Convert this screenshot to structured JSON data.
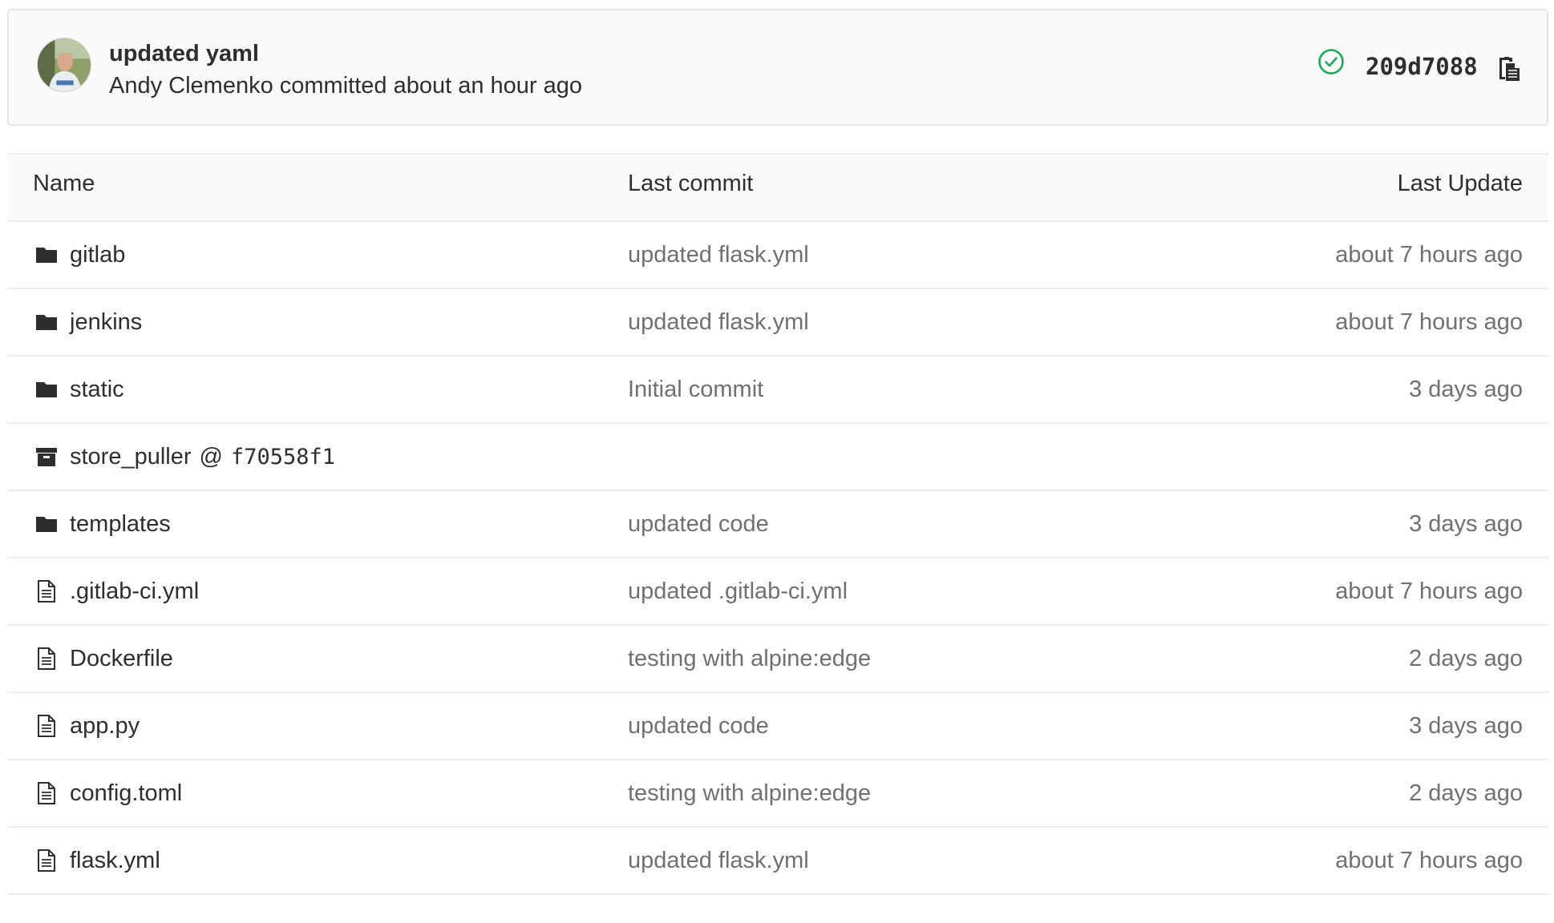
{
  "last_commit": {
    "title": "updated yaml",
    "author": "Andy Clemenko",
    "meta_suffix": " committed about an hour ago",
    "sha": "209d7088",
    "pipeline_icon": "status-success-icon",
    "copy_icon": "clipboard-icon",
    "status_color": "#1aaa55"
  },
  "table": {
    "headers": {
      "name": "Name",
      "last_commit": "Last commit",
      "last_update": "Last Update"
    },
    "rows": [
      {
        "type": "folder",
        "name": "gitlab",
        "commit": "updated flask.yml",
        "updated": "about 7 hours ago"
      },
      {
        "type": "folder",
        "name": "jenkins",
        "commit": "updated flask.yml",
        "updated": "about 7 hours ago"
      },
      {
        "type": "folder",
        "name": "static",
        "commit": "Initial commit",
        "updated": "3 days ago"
      },
      {
        "type": "submodule",
        "name": "store_puller",
        "at": "@",
        "hash": "f70558f1",
        "commit": "",
        "updated": ""
      },
      {
        "type": "folder",
        "name": "templates",
        "commit": "updated code",
        "updated": "3 days ago"
      },
      {
        "type": "file",
        "name": ".gitlab-ci.yml",
        "commit": "updated .gitlab-ci.yml",
        "updated": "about 7 hours ago"
      },
      {
        "type": "file",
        "name": "Dockerfile",
        "commit": "testing with alpine:edge",
        "updated": "2 days ago"
      },
      {
        "type": "file",
        "name": "app.py",
        "commit": "updated code",
        "updated": "3 days ago"
      },
      {
        "type": "file",
        "name": "config.toml",
        "commit": "testing with alpine:edge",
        "updated": "2 days ago"
      },
      {
        "type": "file",
        "name": "flask.yml",
        "commit": "updated flask.yml",
        "updated": "about 7 hours ago"
      }
    ]
  },
  "colors": {
    "text": "#2e2e2e",
    "muted": "#707070",
    "border": "#ececec",
    "panel_bg": "#fafafa"
  }
}
